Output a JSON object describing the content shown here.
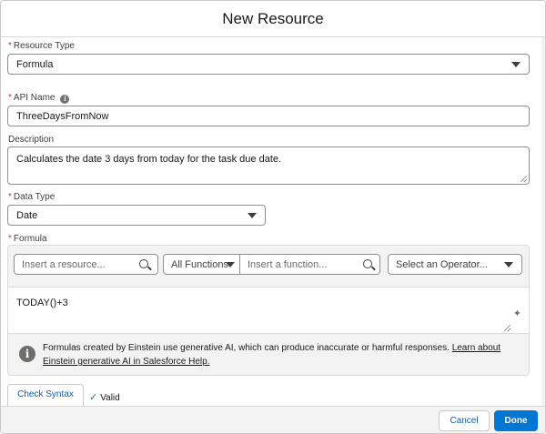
{
  "modal": {
    "title": "New Resource"
  },
  "resource_type": {
    "label": "Resource Type",
    "value": "Formula"
  },
  "api_name": {
    "label": "API Name",
    "value": "ThreeDaysFromNow"
  },
  "description": {
    "label": "Description",
    "value": "Calculates the date 3 days from today for the task due date."
  },
  "data_type": {
    "label": "Data Type",
    "value": "Date"
  },
  "formula": {
    "label": "Formula",
    "resource_placeholder": "Insert a resource...",
    "functions_category": "All Functions",
    "function_placeholder": "Insert a function...",
    "operator_placeholder": "Select an Operator...",
    "expression": "TODAY()+3",
    "notice_text": "Formulas created by Einstein use generative AI, which can produce inaccurate or harmful responses. ",
    "notice_link": "Learn about Einstein generative AI in Salesforce Help."
  },
  "check_syntax": {
    "label": "Check Syntax",
    "status": "Valid"
  },
  "footer": {
    "cancel_label": "Cancel",
    "done_label": "Done"
  },
  "colors": {
    "brand": "#0176d3",
    "link": "#0b5cab",
    "required": "#c23934",
    "valid": "#2e844a"
  }
}
